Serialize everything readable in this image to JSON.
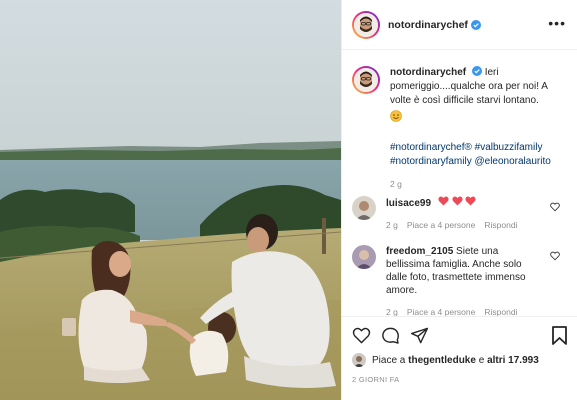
{
  "post": {
    "author": "notordinarychef",
    "more_icon": "more-horizontal-icon",
    "caption": {
      "author": "notordinarychef",
      "text_line": "Ieri pomeriggio....qualche ora per noi!",
      "text_line2": "A volte è così difficile starvi lontano.",
      "emoji": "smiling-face-icon",
      "hashtags_line1": "#notordinarychef® #valbuzzifamily",
      "hashtags_line2": "#notordinaryfamily @eleonoralaurito",
      "age": "2 g"
    },
    "comments": [
      {
        "author": "luisace99",
        "text": "",
        "hearts": 3,
        "age": "2 g",
        "likes": "Piace a 4 persone",
        "reply": "Rispondi"
      },
      {
        "author": "freedom_2105",
        "text": "Siete una bellissima famiglia. Anche solo dalle foto, trasmettete immenso amore.",
        "age": "2 g",
        "likes": "Piace a 4 persone",
        "reply": "Rispondi"
      }
    ],
    "likes_prefix": "Piace a",
    "likes_user": "thegentleduke",
    "likes_mid": "e",
    "likes_others": "altri 17.993",
    "timestamp": "2 GIORNI FA"
  },
  "colors": {
    "verified": "#3897f0",
    "heart_red": "#ed4956",
    "link": "#00376b",
    "meta_gray": "#8e8e8e"
  }
}
